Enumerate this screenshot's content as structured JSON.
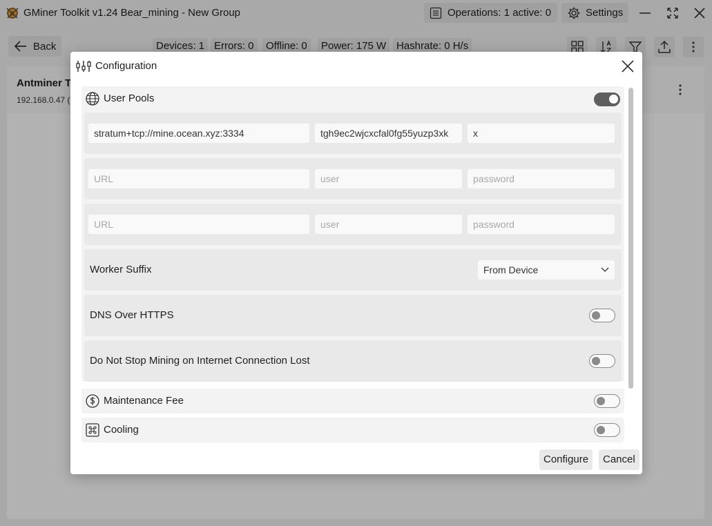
{
  "app": {
    "title": "GMiner Toolkit v1.24 Bear_mining - New Group",
    "operations_label": "Operations: 1 active: 0",
    "settings_label": "Settings"
  },
  "toolbar": {
    "back_label": "Back",
    "stats": {
      "devices": "Devices: 1",
      "errors": "Errors: 0",
      "offline": "Offline: 0",
      "power": "Power: 175 W",
      "hashrate": "Hashrate: 0 H/s"
    }
  },
  "device": {
    "name": "Antminer T2",
    "ip": "192.168.0.47 ("
  },
  "dialog": {
    "title": "Configuration",
    "user_pools": {
      "label": "User Pools",
      "enabled": true,
      "pools": [
        {
          "url": "stratum+tcp://mine.ocean.xyz:3334",
          "user": "tgh9ec2wjcxcfal0fg55yuzp3xk",
          "password": "x"
        },
        {
          "url": "",
          "user": "",
          "password": ""
        },
        {
          "url": "",
          "user": "",
          "password": ""
        }
      ],
      "placeholders": {
        "url": "URL",
        "user": "user",
        "password": "password"
      },
      "worker_suffix_label": "Worker Suffix",
      "worker_suffix_value": "From Device",
      "dns_over_https_label": "DNS Over HTTPS",
      "dns_over_https_enabled": false,
      "no_stop_label": "Do Not Stop Mining on Internet Connection Lost",
      "no_stop_enabled": false
    },
    "maintenance_fee": {
      "label": "Maintenance Fee",
      "enabled": false
    },
    "cooling": {
      "label": "Cooling",
      "enabled": false
    },
    "configure_label": "Configure",
    "cancel_label": "Cancel"
  },
  "colors": {
    "toggle_on": "#5f5f5f",
    "toggle_off": "#8a8a8a",
    "section_bg": "#f3f3f3",
    "row_bg": "#e9e9e9"
  }
}
